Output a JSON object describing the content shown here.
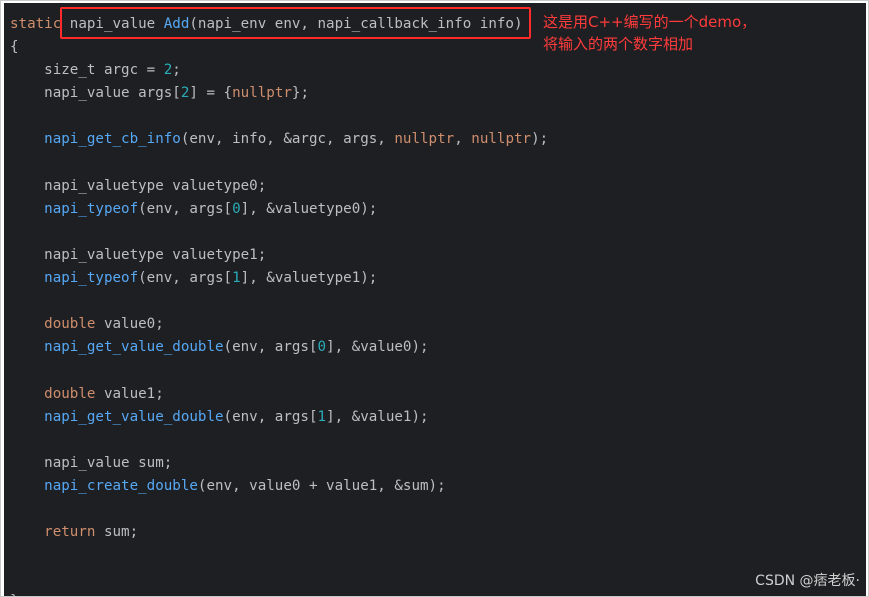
{
  "code_lines": [
    [
      {
        "t": "static ",
        "c": "kw"
      },
      {
        "t": "napi_value ",
        "c": "plain"
      },
      {
        "t": "Add",
        "c": "fn"
      },
      {
        "t": "(napi_env env, napi_callback_info info)",
        "c": "plain"
      }
    ],
    [
      {
        "t": "{",
        "c": "plain"
      }
    ],
    [
      {
        "t": "    size_t argc = ",
        "c": "plain"
      },
      {
        "t": "2",
        "c": "num"
      },
      {
        "t": ";",
        "c": "plain"
      }
    ],
    [
      {
        "t": "    napi_value args[",
        "c": "plain"
      },
      {
        "t": "2",
        "c": "num"
      },
      {
        "t": "] = {",
        "c": "plain"
      },
      {
        "t": "nullptr",
        "c": "kw"
      },
      {
        "t": "};",
        "c": "plain"
      }
    ],
    [],
    [
      {
        "t": "    ",
        "c": "plain"
      },
      {
        "t": "napi_get_cb_info",
        "c": "fn"
      },
      {
        "t": "(env, info, &argc, args, ",
        "c": "plain"
      },
      {
        "t": "nullptr",
        "c": "kw"
      },
      {
        "t": ", ",
        "c": "plain"
      },
      {
        "t": "nullptr",
        "c": "kw"
      },
      {
        "t": ");",
        "c": "plain"
      }
    ],
    [],
    [
      {
        "t": "    napi_valuetype valuetype0;",
        "c": "plain"
      }
    ],
    [
      {
        "t": "    ",
        "c": "plain"
      },
      {
        "t": "napi_typeof",
        "c": "fn"
      },
      {
        "t": "(env, args[",
        "c": "plain"
      },
      {
        "t": "0",
        "c": "num"
      },
      {
        "t": "], &valuetype0);",
        "c": "plain"
      }
    ],
    [],
    [
      {
        "t": "    napi_valuetype valuetype1;",
        "c": "plain"
      }
    ],
    [
      {
        "t": "    ",
        "c": "plain"
      },
      {
        "t": "napi_typeof",
        "c": "fn"
      },
      {
        "t": "(env, args[",
        "c": "plain"
      },
      {
        "t": "1",
        "c": "num"
      },
      {
        "t": "], &valuetype1);",
        "c": "plain"
      }
    ],
    [],
    [
      {
        "t": "    ",
        "c": "plain"
      },
      {
        "t": "double",
        "c": "kw"
      },
      {
        "t": " value0;",
        "c": "plain"
      }
    ],
    [
      {
        "t": "    ",
        "c": "plain"
      },
      {
        "t": "napi_get_value_double",
        "c": "fn"
      },
      {
        "t": "(env, args[",
        "c": "plain"
      },
      {
        "t": "0",
        "c": "num"
      },
      {
        "t": "], &value0);",
        "c": "plain"
      }
    ],
    [],
    [
      {
        "t": "    ",
        "c": "plain"
      },
      {
        "t": "double",
        "c": "kw"
      },
      {
        "t": " value1;",
        "c": "plain"
      }
    ],
    [
      {
        "t": "    ",
        "c": "plain"
      },
      {
        "t": "napi_get_value_double",
        "c": "fn"
      },
      {
        "t": "(env, args[",
        "c": "plain"
      },
      {
        "t": "1",
        "c": "num"
      },
      {
        "t": "], &value1);",
        "c": "plain"
      }
    ],
    [],
    [
      {
        "t": "    napi_value sum;",
        "c": "plain"
      }
    ],
    [
      {
        "t": "    ",
        "c": "plain"
      },
      {
        "t": "napi_create_double",
        "c": "fn"
      },
      {
        "t": "(env, value0 + value1, &sum);",
        "c": "plain"
      }
    ],
    [],
    [
      {
        "t": "    ",
        "c": "plain"
      },
      {
        "t": "return",
        "c": "kw"
      },
      {
        "t": " sum;",
        "c": "plain"
      }
    ],
    [],
    [],
    [
      {
        "t": "}",
        "c": "plain"
      }
    ]
  ],
  "annotation": {
    "line1": "这是用C++编写的一个demo，",
    "line2": "将输入的两个数字相加"
  },
  "watermark": "CSDN @痞老板·",
  "colors": {
    "background": "#1e1f22",
    "keyword": "#cf8e6d",
    "function": "#56a8f5",
    "number": "#2aacb8",
    "text": "#bcbec4",
    "highlight_box": "#ff2a2a",
    "annotation": "#ff3b3b"
  }
}
